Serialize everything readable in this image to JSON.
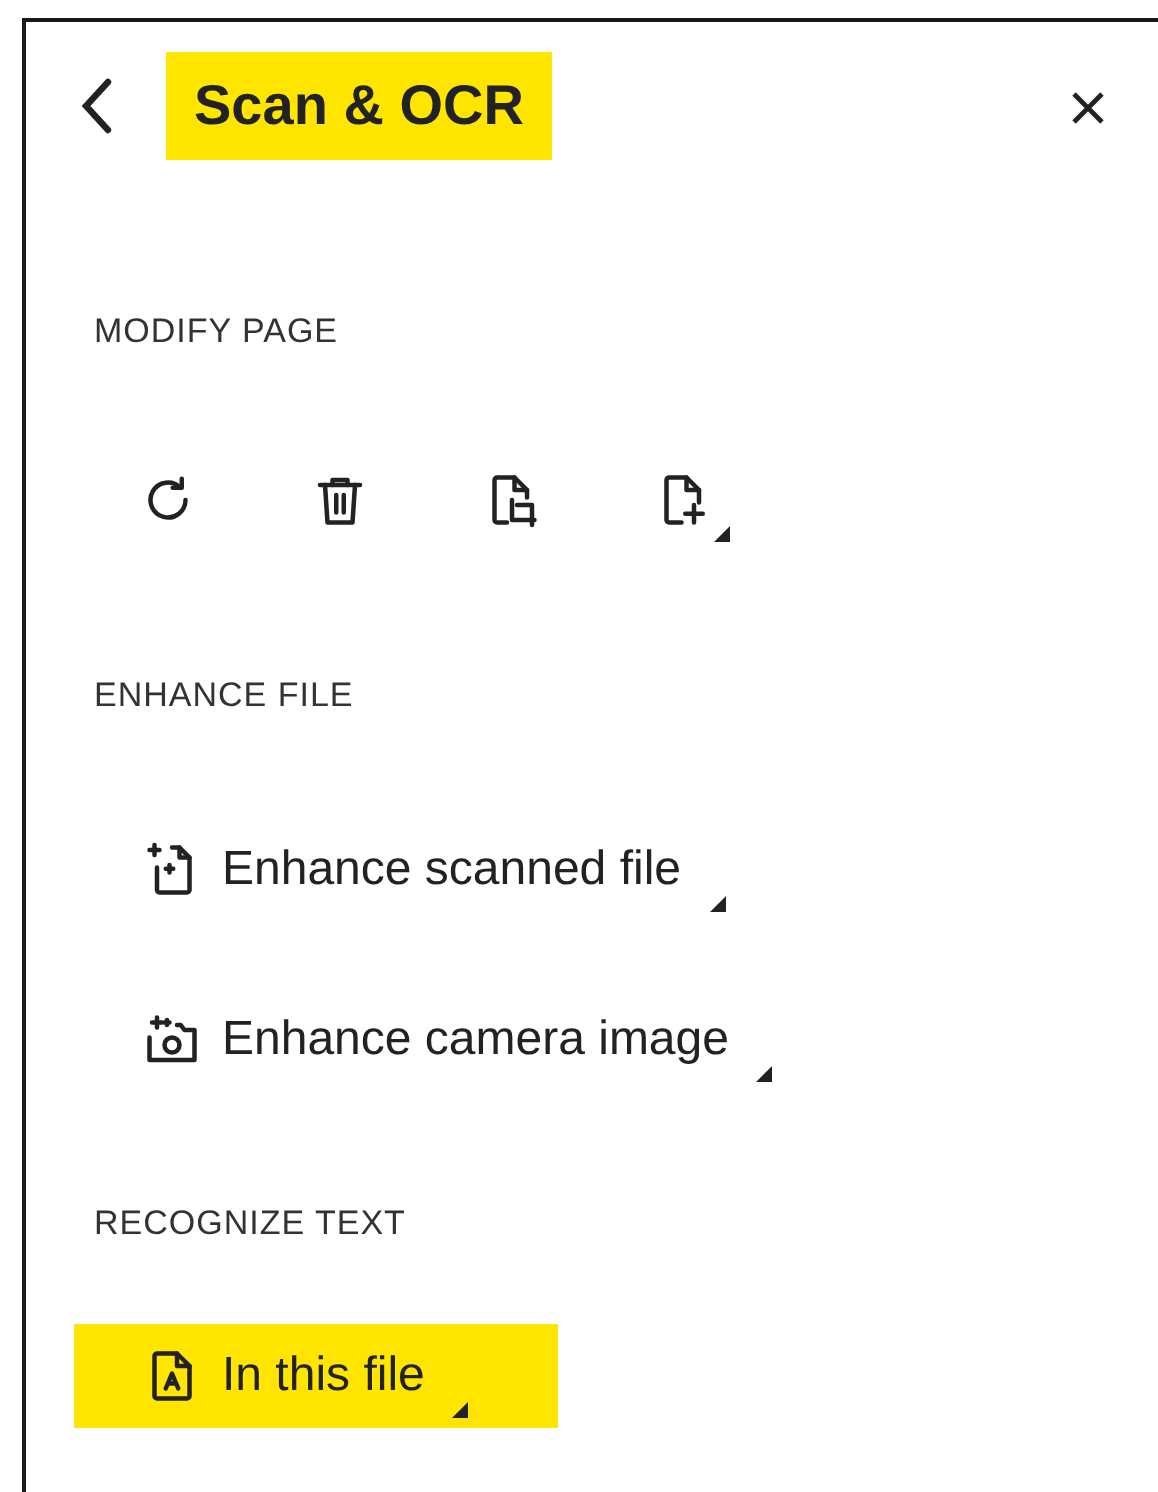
{
  "header": {
    "title": "Scan & OCR",
    "title_highlighted": true
  },
  "sections": [
    {
      "heading": "MODIFY PAGE",
      "items": [
        {
          "kind": "icon",
          "has_menu": false
        },
        {
          "kind": "icon",
          "has_menu": false
        },
        {
          "kind": "icon",
          "has_menu": false
        },
        {
          "kind": "icon",
          "has_menu": true
        }
      ]
    },
    {
      "heading": "ENHANCE FILE",
      "items": [
        {
          "kind": "row",
          "label": "Enhance scanned file",
          "has_menu": true,
          "highlighted": false
        },
        {
          "kind": "row",
          "label": "Enhance camera image",
          "has_menu": true,
          "highlighted": false
        }
      ]
    },
    {
      "heading": "RECOGNIZE TEXT",
      "items": [
        {
          "kind": "row",
          "label": "In this file",
          "has_menu": true,
          "highlighted": true
        }
      ]
    }
  ]
}
